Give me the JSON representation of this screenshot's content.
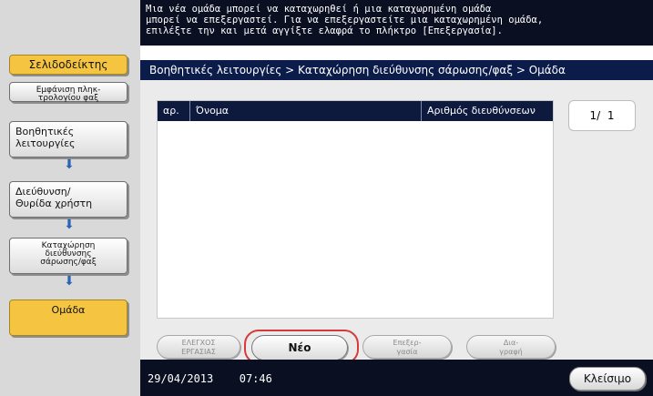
{
  "left_nav": {
    "bookmark_label": "Σελιδοδείκτης",
    "items": [
      {
        "label": "Εμφάνιση πληκ-\nτρολογίου φαξ"
      },
      {
        "label": "Βοηθητικές\nλειτουργίες"
      },
      {
        "label": "Διεύθυνση/\nΘυρίδα χρήστη"
      },
      {
        "label": "Καταχώρηση\nδιεύθυνσης\nσάρωσης/φαξ"
      },
      {
        "label": "Ομάδα"
      }
    ]
  },
  "top_message": "Μια νέα ομάδα μπορεί να καταχωρηθεί ή μια καταχωρημένη ομάδα\nμπορεί να επεξεργαστεί. Για να επεξεργαστείτε μια καταχωρημένη ομάδα,\nεπιλέξτε την και μετά αγγίξτε ελαφρά το πλήκτρο [Επεξεργασία].",
  "breadcrumb": "Βοηθητικές λειτουργίες > Καταχώρηση διεύθυνσης σάρωσης/φαξ > Ομάδα",
  "table": {
    "headers": [
      "αρ.",
      "Όνομα",
      "Αριθμός διευθύνσεων"
    ]
  },
  "pager": {
    "text": "1/  1"
  },
  "actions": {
    "check_job": "ΕΛΕΓΧΟΣ\nΕΡΓΑΣΙΑΣ",
    "new": "Νέο",
    "edit": "Επεξερ-\nγασία",
    "delete": "Δια-\nγραφή"
  },
  "footer": {
    "date": "29/04/2013",
    "time": "07:46",
    "close_label": "Κλείσιμο"
  }
}
